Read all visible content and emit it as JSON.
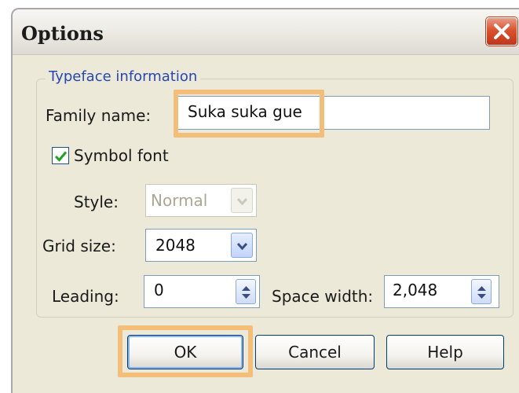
{
  "window": {
    "title": "Options",
    "close_icon": "close-icon"
  },
  "typeface": {
    "legend": "Typeface information",
    "family_label": "Family name:",
    "family_value": "Suka suka gue",
    "symbol_label": "Symbol font",
    "symbol_checked": true,
    "style_label": "Style:",
    "style_value": "Normal",
    "style_enabled": false,
    "grid_label": "Grid size:",
    "grid_value": "2048",
    "leading_label": "Leading:",
    "leading_value": "0",
    "space_label": "Space width:",
    "space_value": "2,048"
  },
  "buttons": {
    "ok": "OK",
    "cancel": "Cancel",
    "help": "Help"
  },
  "colors": {
    "dialog_bg": "#ece9d8",
    "legend_text": "#2646b2",
    "highlight": "#f3be7a",
    "close_red": "#d9532f"
  }
}
